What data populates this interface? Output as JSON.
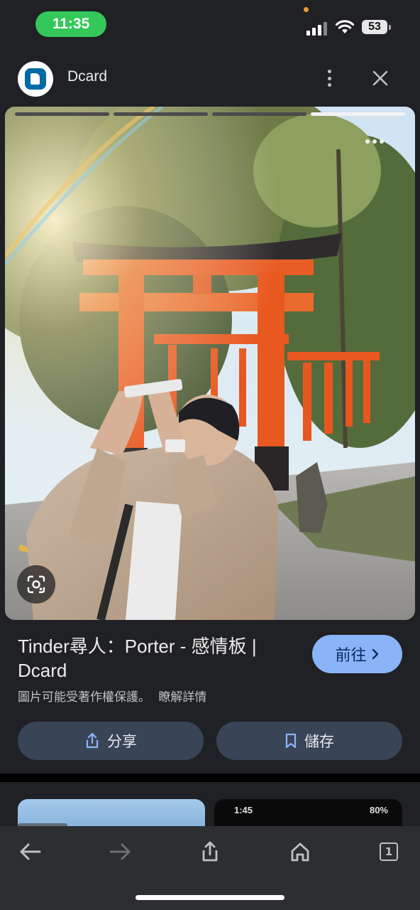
{
  "status_bar": {
    "time": "11:35",
    "battery_level": "53",
    "icons": [
      "cellular-signal-icon",
      "wifi-icon",
      "battery-icon"
    ]
  },
  "app_bar": {
    "site_name": "Dcard",
    "icons": [
      "dcard-logo",
      "more-vert-icon",
      "close-icon"
    ]
  },
  "image_viewer": {
    "story_progress_segments": 4,
    "active_segment": 4,
    "icons": [
      "more-horizontal-icon",
      "google-lens-icon"
    ]
  },
  "result": {
    "title": "Tinder尋人：Porter - 感情板 | Dcard",
    "visit_label": "前往",
    "copyright_notice": "圖片可能受著作權保護。",
    "learn_more_label": "瞭解詳情",
    "share_label": "分享",
    "save_label": "儲存"
  },
  "related_thumbnail": {
    "status_time": "1:45",
    "status_battery": "80%"
  },
  "toolbar": {
    "tab_count": "1",
    "icons": [
      "back-icon",
      "forward-icon",
      "share-icon",
      "home-icon",
      "tabs-icon"
    ]
  },
  "colors": {
    "background": "#202124",
    "accent_button": "#8ab4f8",
    "secondary_button": "#394457",
    "time_pill": "#34c759",
    "toolbar": "#2d2e31"
  }
}
